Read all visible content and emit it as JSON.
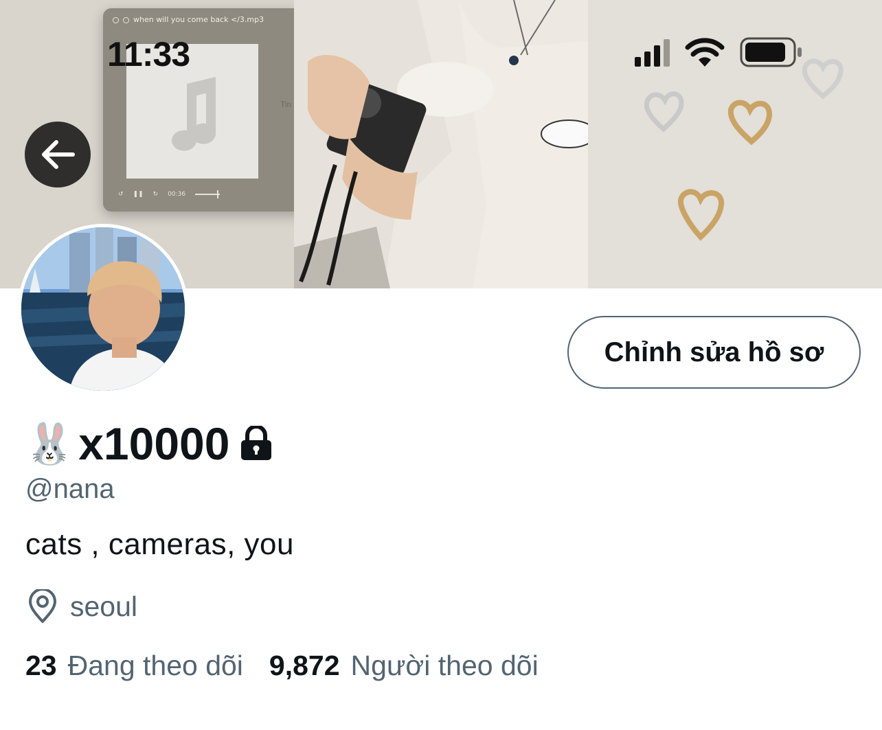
{
  "status_bar": {
    "time": "11:33",
    "signal_icon": "cellular-signal-icon",
    "wifi_icon": "wifi-icon",
    "battery_icon": "battery-icon"
  },
  "banner": {
    "player_title": "when will you come back </3.mp3",
    "player_time": "00:36",
    "side_text": "Tin"
  },
  "header": {
    "back_icon": "back-arrow-icon"
  },
  "profile": {
    "name_emoji": "🐰",
    "display_name": "x10000",
    "protected_icon": "lock-icon",
    "handle": "@nana",
    "bio": "cats , cameras, you",
    "location_icon": "location-pin-icon",
    "location": "seoul",
    "edit_button_label": "Chỉnh sửa hồ sơ",
    "following_count": "23",
    "following_label": "Đang theo dõi",
    "followers_count": "9,872",
    "followers_label": "Người theo dõi"
  },
  "colors": {
    "text_primary": "#0f1419",
    "text_secondary": "#536471",
    "button_border": "#536471",
    "back_button_bg": "#2f2e2c"
  }
}
